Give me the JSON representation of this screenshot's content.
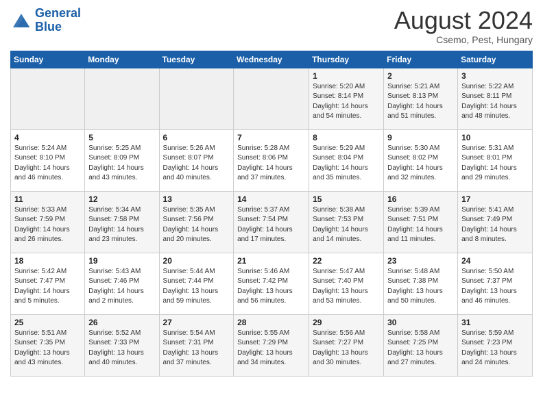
{
  "logo": {
    "name1": "General",
    "name2": "Blue"
  },
  "header": {
    "month": "August 2024",
    "location": "Csemo, Pest, Hungary"
  },
  "days_of_week": [
    "Sunday",
    "Monday",
    "Tuesday",
    "Wednesday",
    "Thursday",
    "Friday",
    "Saturday"
  ],
  "weeks": [
    [
      {
        "day": "",
        "info": ""
      },
      {
        "day": "",
        "info": ""
      },
      {
        "day": "",
        "info": ""
      },
      {
        "day": "",
        "info": ""
      },
      {
        "day": "1",
        "info": "Sunrise: 5:20 AM\nSunset: 8:14 PM\nDaylight: 14 hours\nand 54 minutes."
      },
      {
        "day": "2",
        "info": "Sunrise: 5:21 AM\nSunset: 8:13 PM\nDaylight: 14 hours\nand 51 minutes."
      },
      {
        "day": "3",
        "info": "Sunrise: 5:22 AM\nSunset: 8:11 PM\nDaylight: 14 hours\nand 48 minutes."
      }
    ],
    [
      {
        "day": "4",
        "info": "Sunrise: 5:24 AM\nSunset: 8:10 PM\nDaylight: 14 hours\nand 46 minutes."
      },
      {
        "day": "5",
        "info": "Sunrise: 5:25 AM\nSunset: 8:09 PM\nDaylight: 14 hours\nand 43 minutes."
      },
      {
        "day": "6",
        "info": "Sunrise: 5:26 AM\nSunset: 8:07 PM\nDaylight: 14 hours\nand 40 minutes."
      },
      {
        "day": "7",
        "info": "Sunrise: 5:28 AM\nSunset: 8:06 PM\nDaylight: 14 hours\nand 37 minutes."
      },
      {
        "day": "8",
        "info": "Sunrise: 5:29 AM\nSunset: 8:04 PM\nDaylight: 14 hours\nand 35 minutes."
      },
      {
        "day": "9",
        "info": "Sunrise: 5:30 AM\nSunset: 8:02 PM\nDaylight: 14 hours\nand 32 minutes."
      },
      {
        "day": "10",
        "info": "Sunrise: 5:31 AM\nSunset: 8:01 PM\nDaylight: 14 hours\nand 29 minutes."
      }
    ],
    [
      {
        "day": "11",
        "info": "Sunrise: 5:33 AM\nSunset: 7:59 PM\nDaylight: 14 hours\nand 26 minutes."
      },
      {
        "day": "12",
        "info": "Sunrise: 5:34 AM\nSunset: 7:58 PM\nDaylight: 14 hours\nand 23 minutes."
      },
      {
        "day": "13",
        "info": "Sunrise: 5:35 AM\nSunset: 7:56 PM\nDaylight: 14 hours\nand 20 minutes."
      },
      {
        "day": "14",
        "info": "Sunrise: 5:37 AM\nSunset: 7:54 PM\nDaylight: 14 hours\nand 17 minutes."
      },
      {
        "day": "15",
        "info": "Sunrise: 5:38 AM\nSunset: 7:53 PM\nDaylight: 14 hours\nand 14 minutes."
      },
      {
        "day": "16",
        "info": "Sunrise: 5:39 AM\nSunset: 7:51 PM\nDaylight: 14 hours\nand 11 minutes."
      },
      {
        "day": "17",
        "info": "Sunrise: 5:41 AM\nSunset: 7:49 PM\nDaylight: 14 hours\nand 8 minutes."
      }
    ],
    [
      {
        "day": "18",
        "info": "Sunrise: 5:42 AM\nSunset: 7:47 PM\nDaylight: 14 hours\nand 5 minutes."
      },
      {
        "day": "19",
        "info": "Sunrise: 5:43 AM\nSunset: 7:46 PM\nDaylight: 14 hours\nand 2 minutes."
      },
      {
        "day": "20",
        "info": "Sunrise: 5:44 AM\nSunset: 7:44 PM\nDaylight: 13 hours\nand 59 minutes."
      },
      {
        "day": "21",
        "info": "Sunrise: 5:46 AM\nSunset: 7:42 PM\nDaylight: 13 hours\nand 56 minutes."
      },
      {
        "day": "22",
        "info": "Sunrise: 5:47 AM\nSunset: 7:40 PM\nDaylight: 13 hours\nand 53 minutes."
      },
      {
        "day": "23",
        "info": "Sunrise: 5:48 AM\nSunset: 7:38 PM\nDaylight: 13 hours\nand 50 minutes."
      },
      {
        "day": "24",
        "info": "Sunrise: 5:50 AM\nSunset: 7:37 PM\nDaylight: 13 hours\nand 46 minutes."
      }
    ],
    [
      {
        "day": "25",
        "info": "Sunrise: 5:51 AM\nSunset: 7:35 PM\nDaylight: 13 hours\nand 43 minutes."
      },
      {
        "day": "26",
        "info": "Sunrise: 5:52 AM\nSunset: 7:33 PM\nDaylight: 13 hours\nand 40 minutes."
      },
      {
        "day": "27",
        "info": "Sunrise: 5:54 AM\nSunset: 7:31 PM\nDaylight: 13 hours\nand 37 minutes."
      },
      {
        "day": "28",
        "info": "Sunrise: 5:55 AM\nSunset: 7:29 PM\nDaylight: 13 hours\nand 34 minutes."
      },
      {
        "day": "29",
        "info": "Sunrise: 5:56 AM\nSunset: 7:27 PM\nDaylight: 13 hours\nand 30 minutes."
      },
      {
        "day": "30",
        "info": "Sunrise: 5:58 AM\nSunset: 7:25 PM\nDaylight: 13 hours\nand 27 minutes."
      },
      {
        "day": "31",
        "info": "Sunrise: 5:59 AM\nSunset: 7:23 PM\nDaylight: 13 hours\nand 24 minutes."
      }
    ]
  ]
}
